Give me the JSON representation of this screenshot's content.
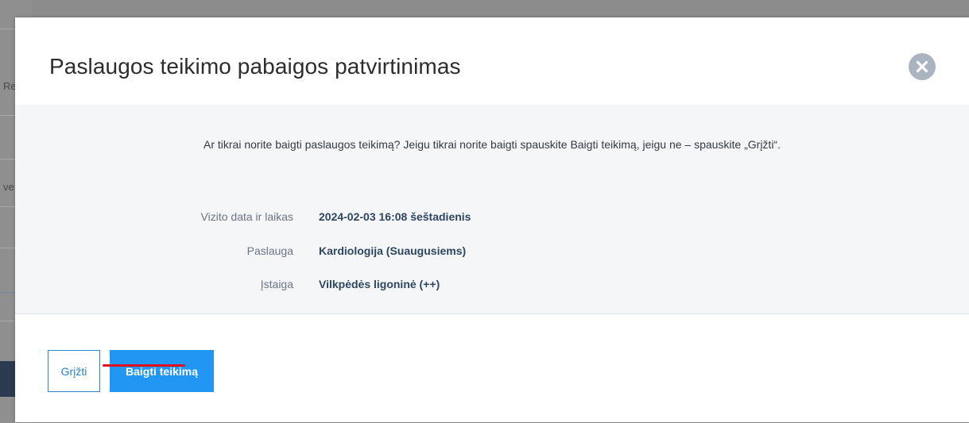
{
  "background": {
    "fragments": [
      "Re",
      "ve"
    ]
  },
  "modal": {
    "title": "Paslaugos teikimo pabaigos patvirtinimas",
    "close_icon": "close-circle-icon",
    "intro": "Ar tikrai norite baigti paslaugos teikimą? Jeigu tikrai norite baigti spauskite Baigti teikimą, jeigu ne – spauskite „Grįžti“.",
    "details": [
      {
        "label": "Vizito data ir laikas",
        "value": "2024-02-03 16:08 šeštadienis"
      },
      {
        "label": "Paslauga",
        "value": "Kardiologija (Suaugusiems)"
      },
      {
        "label": "Įstaiga",
        "value": "Vilkpėdės ligoninė (++)"
      }
    ],
    "buttons": {
      "back": "Grįžti",
      "finish": "Baigti teikimą"
    }
  },
  "colors": {
    "primary": "#2196f3",
    "highlight_underline": "#e0101f"
  }
}
